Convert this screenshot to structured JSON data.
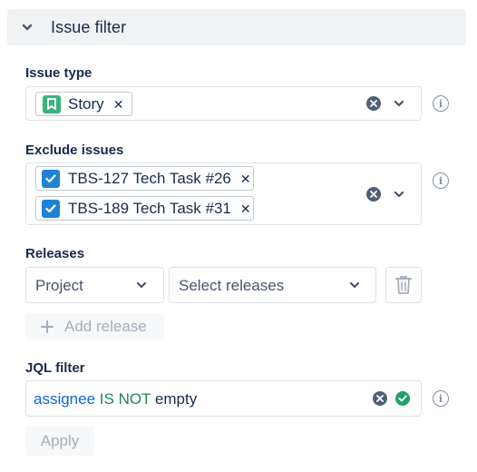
{
  "header": {
    "title": "Issue filter",
    "icon": "chevron-down-icon"
  },
  "issue_type": {
    "label": "Issue type",
    "chips": [
      {
        "label": "Story",
        "icon": "story-icon",
        "color": "#36b37e"
      }
    ]
  },
  "exclude_issues": {
    "label": "Exclude issues",
    "chips": [
      {
        "label": "TBS-127 Tech Task #26",
        "checked": true
      },
      {
        "label": "TBS-189 Tech Task #31",
        "checked": true
      }
    ]
  },
  "releases": {
    "label": "Releases",
    "project_select": "Project",
    "releases_select": "Select releases",
    "add_release_label": "Add release"
  },
  "jql_filter": {
    "label": "JQL filter",
    "tokens": {
      "field": "assignee",
      "operator": "IS NOT",
      "value": "empty"
    },
    "apply_label": "Apply",
    "valid": true
  },
  "colors": {
    "accent": "#1f82d7",
    "success": "#22a06b",
    "story": "#36b37e"
  }
}
